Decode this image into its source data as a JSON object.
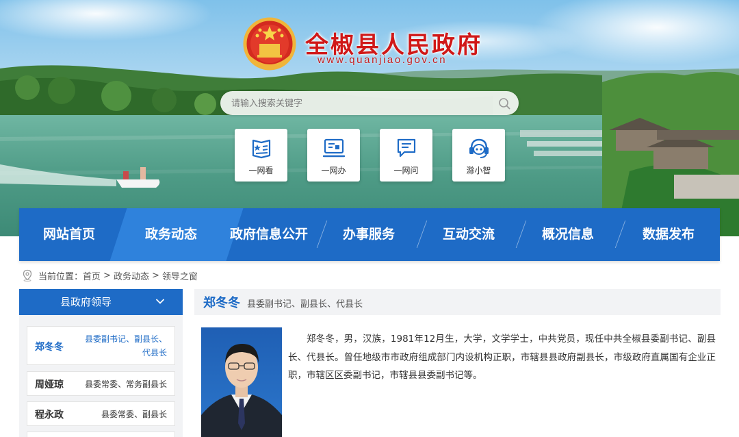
{
  "site": {
    "title": "全椒县人民政府",
    "url": "www.quanjiao.gov.cn"
  },
  "search": {
    "placeholder": "请输入搜索关键字",
    "icon": "search-icon"
  },
  "quick_links": [
    {
      "label": "一网看",
      "icon": "newspaper-icon"
    },
    {
      "label": "一网办",
      "icon": "computer-icon"
    },
    {
      "label": "一网问",
      "icon": "message-icon"
    },
    {
      "label": "滁小智",
      "icon": "headset-robot-icon"
    }
  ],
  "nav": {
    "active_index": 1,
    "items": [
      "网站首页",
      "政务动态",
      "政府信息公开",
      "办事服务",
      "互动交流",
      "概况信息",
      "数据发布"
    ]
  },
  "breadcrumb": {
    "prefix": "当前位置：",
    "items": [
      "首页",
      "政务动态",
      "领导之窗"
    ],
    "separator": ">"
  },
  "sidebar": {
    "title": "县政府领导",
    "leaders": [
      {
        "name": "郑冬冬",
        "role_line1": "县委副书记、副县长、",
        "role_line2": "代县长",
        "active": true
      },
      {
        "name": "周娅琼",
        "role_line1": "县委常委、常务副县长",
        "role_line2": "",
        "active": false
      },
      {
        "name": "程永政",
        "role_line1": "县委常委、副县长",
        "role_line2": "",
        "active": false
      }
    ]
  },
  "profile": {
    "name": "郑冬冬",
    "role": "县委副书记、副县长、代县长",
    "bio": "郑冬冬，男，汉族，1981年12月生，大学，文学学士，中共党员，现任中共全椒县委副书记、副县长、代县长。曾任地级市市政府组成部门内设机构正职，市辖县县政府副县长，市级政府直属国有企业正职，市辖区区委副书记，市辖县县委副书记等。"
  },
  "colors": {
    "primary_blue": "#1e6bc6",
    "active_nav": "#2f82dc",
    "title_red": "#d01818",
    "panel_gray": "#f2f3f5"
  }
}
